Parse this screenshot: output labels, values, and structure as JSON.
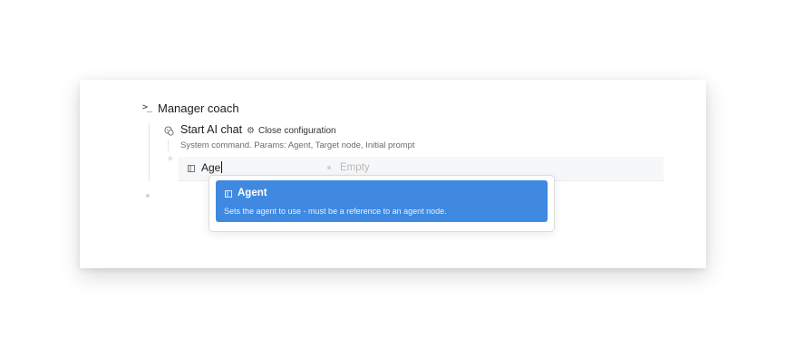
{
  "block": {
    "title": "Manager coach",
    "terminal_icon": ">_"
  },
  "command": {
    "title": "Start AI chat",
    "close_label": "Close configuration",
    "description": "System command. Params: Agent, Target node, Initial prompt"
  },
  "param": {
    "value": "Age",
    "empty_label": "Empty"
  },
  "dropdown": {
    "options": [
      {
        "label": "Agent",
        "description": "Sets the agent to use - must be a reference to an agent node."
      }
    ]
  },
  "colors": {
    "accent": "#3f89e0"
  }
}
